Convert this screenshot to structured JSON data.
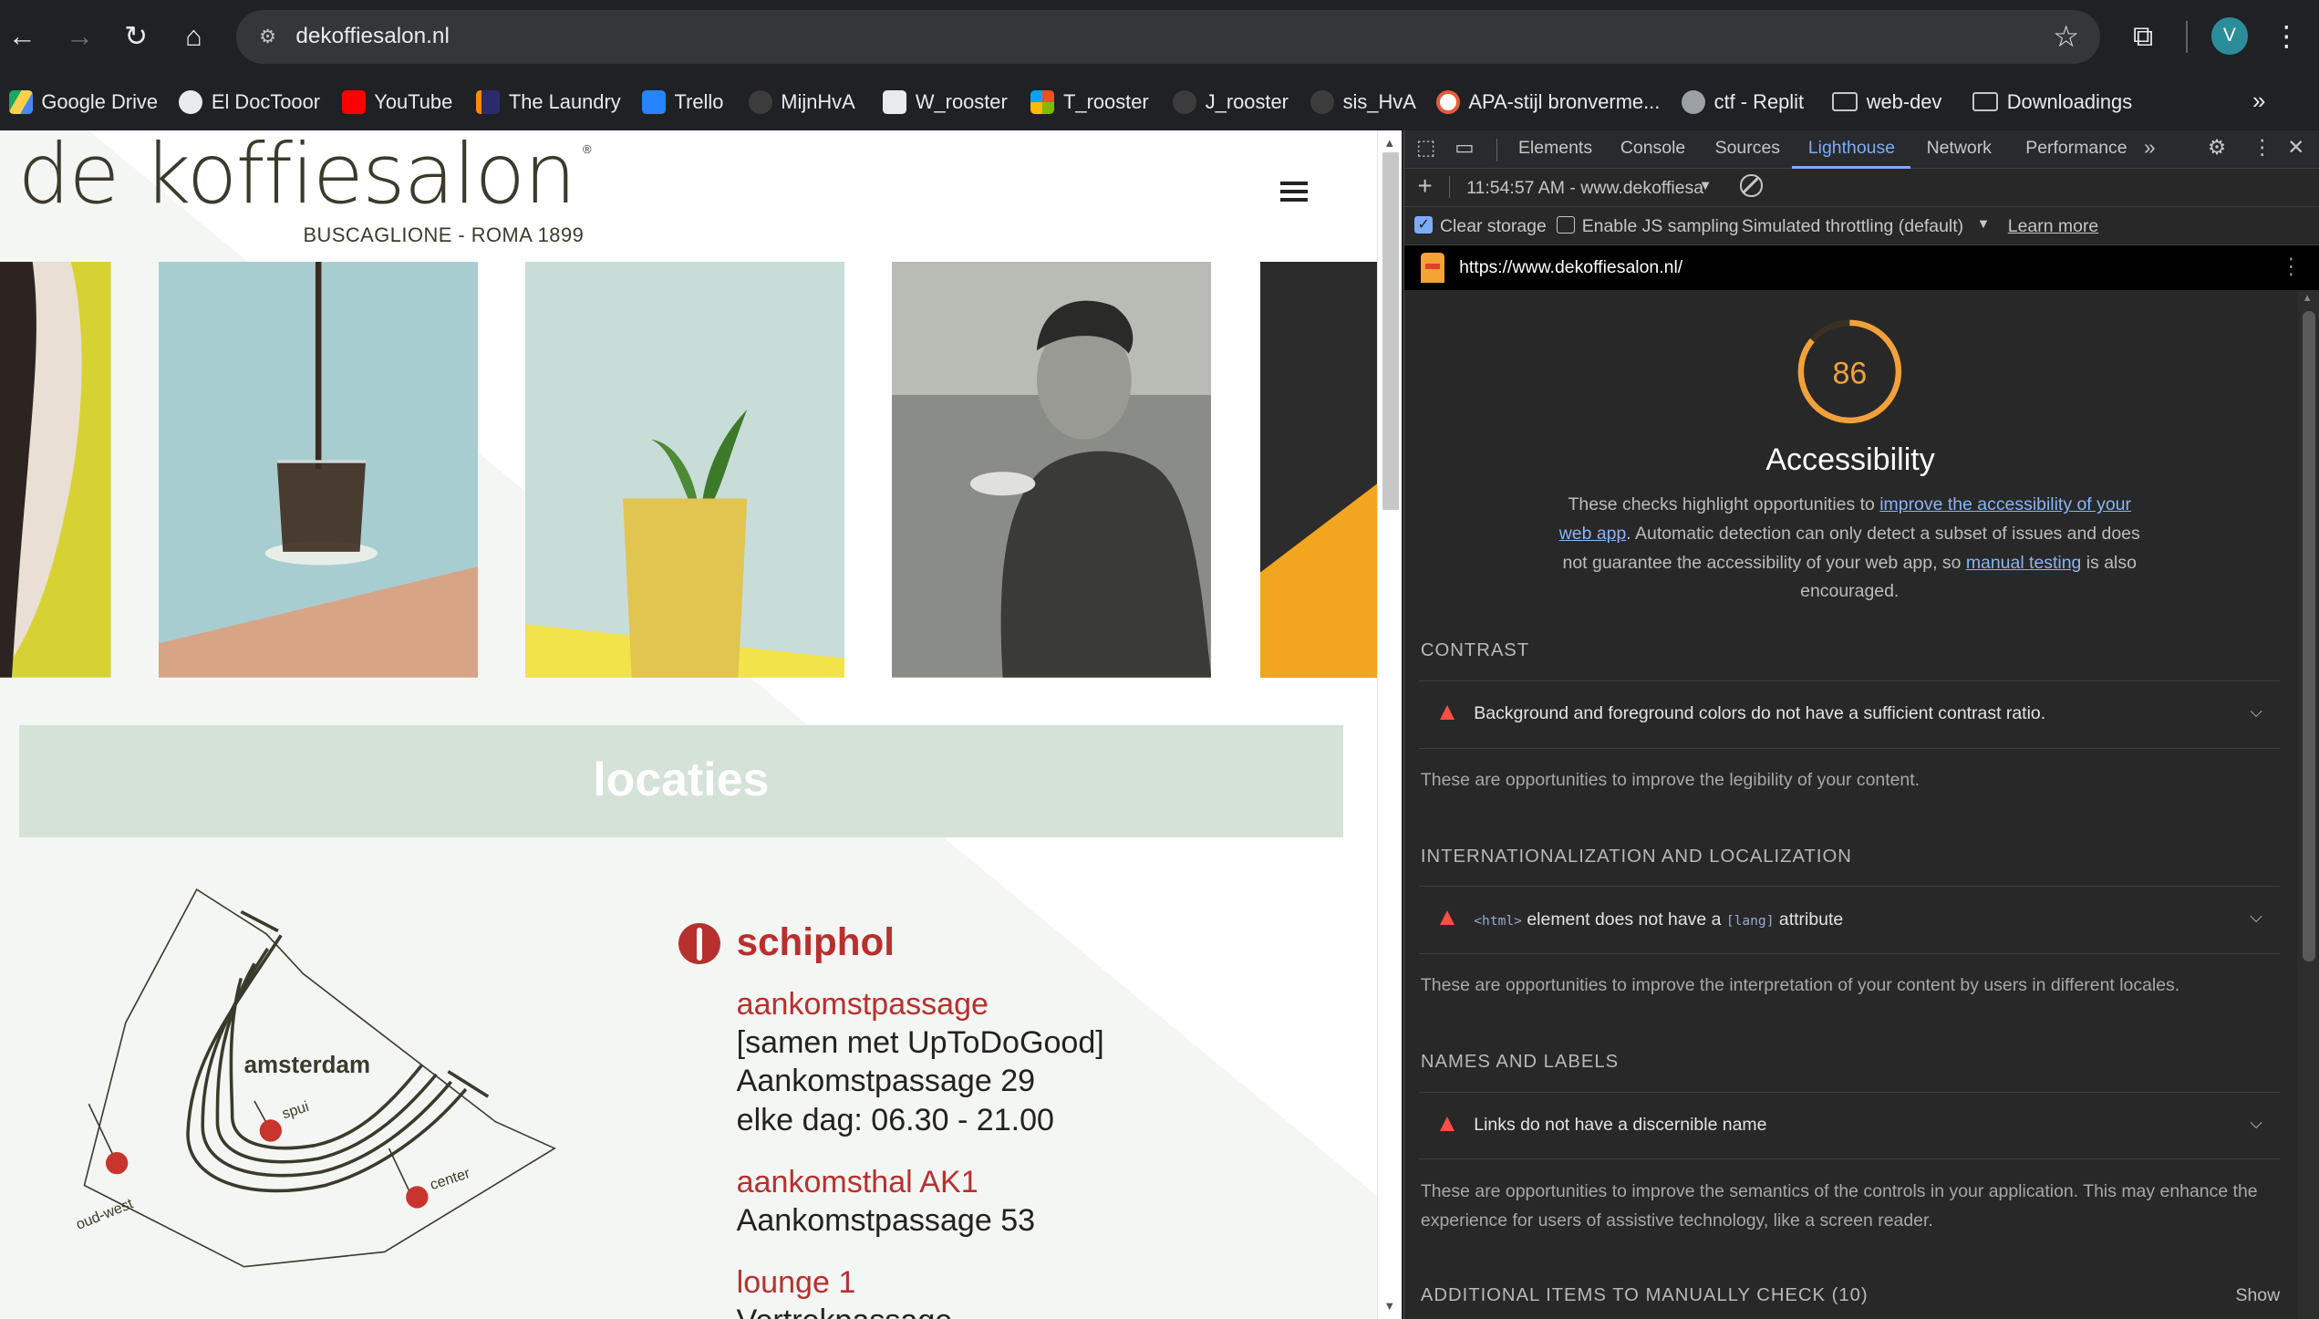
{
  "browser": {
    "url": "dekoffiesalon.nl",
    "bookmarks": [
      "Google Drive",
      "El DocTooor",
      "YouTube",
      "The Laundry",
      "Trello",
      "MijnHvA",
      "W_rooster",
      "T_rooster",
      "J_rooster",
      "sis_HvA",
      "APA-stijl bronverme...",
      "ctf - Replit",
      "web-dev",
      "Downloadings"
    ],
    "profile_initial": "V"
  },
  "site": {
    "logo_main": "de koffiesalon",
    "logo_sub": "BUSCAGLIONE - ROMA 1899",
    "locaties_heading": "locaties",
    "map": {
      "city": "amsterdam",
      "pins": [
        "spui",
        "center",
        "oud-west"
      ]
    },
    "location_title": "schiphol",
    "entries": [
      {
        "name": "aankomstpassage",
        "lines": [
          "[samen met UpToDoGood]",
          "Aankomstpassage 29",
          "elke dag: 06.30 - 21.00"
        ]
      },
      {
        "name": "aankomsthal AK1",
        "lines": [
          "Aankomstpassage 53"
        ]
      },
      {
        "name": "lounge 1",
        "lines": [
          "Vertrekpassage"
        ]
      }
    ]
  },
  "devtools": {
    "tabs": [
      "Elements",
      "Console",
      "Sources",
      "Lighthouse",
      "Network",
      "Performance"
    ],
    "active_tab": "Lighthouse",
    "report_select": "11:54:57 AM - www.dekoffiesa",
    "clear_storage": "Clear storage",
    "js_sampling": "Enable JS sampling",
    "throttling": "Simulated throttling (default)",
    "learn_more": "Learn more",
    "report_url": "https://www.dekoffiesalon.nl/",
    "score": 86,
    "category": "Accessibility",
    "intro": {
      "p1": "These checks highlight opportunities to ",
      "link1": "improve the accessibility of your web app",
      "p2": ". Automatic detection can only detect a subset of issues and does not guarantee the accessibility of your web app, so ",
      "link2": "manual testing",
      "p3": " is also encouraged."
    },
    "groups": [
      {
        "title": "CONTRAST",
        "audit": "Background and foreground colors do not have a sufficient contrast ratio.",
        "desc": "These are opportunities to improve the legibility of your content."
      },
      {
        "title": "INTERNATIONALIZATION AND LOCALIZATION",
        "audit_code1": "<html>",
        "audit_mid": " element does not have a ",
        "audit_code2": "[lang]",
        "audit_end": " attribute",
        "desc": "These are opportunities to improve the interpretation of your content by users in different locales."
      },
      {
        "title": "NAMES AND LABELS",
        "audit": "Links do not have a discernible name",
        "desc": "These are opportunities to improve the semantics of the controls in your application. This may enhance the experience for users of assistive technology, like a screen reader."
      }
    ],
    "manual_check": "ADDITIONAL ITEMS TO MANUALLY CHECK (10)",
    "show": "Show"
  },
  "colors": {
    "score": "#f2a13a",
    "fail": "#ff4e42",
    "brand_red": "#b8302e",
    "locaties_bg": "#d5e2d8"
  }
}
